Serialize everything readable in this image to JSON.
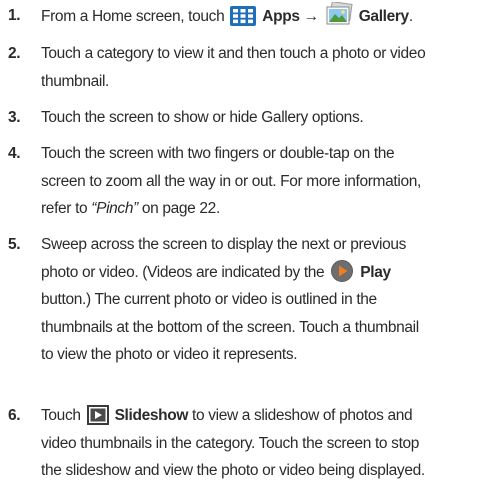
{
  "steps": [
    {
      "num": "1.",
      "parts": {
        "a": "From a Home screen, touch",
        "apps": "Apps",
        "arrow": "→",
        "gallery": "Gallery",
        "end": "."
      }
    },
    {
      "num": "2.",
      "lines": [
        "Touch a category to view it and then touch a photo or video",
        "thumbnail."
      ]
    },
    {
      "num": "3.",
      "lines": [
        "Touch the screen to show or hide Gallery options."
      ]
    },
    {
      "num": "4.",
      "lines": [
        "Touch the screen with two fingers or double-tap on the",
        "screen to zoom all the way in or out. For more information,"
      ],
      "line3": {
        "a": "refer to ",
        "ref": "“Pinch”",
        "b": " on page 22."
      }
    },
    {
      "num": "5.",
      "line1": "Sweep across the screen to display the next or previous",
      "line2": {
        "a": "photo or video. (Videos are indicated by the",
        "play": "Play"
      },
      "lines": [
        "button.) The current photo or video is outlined in the",
        "thumbnails at the bottom of the screen. Touch a thumbnail",
        "to view the photo or video it represents."
      ]
    },
    {
      "num": "6.",
      "line1": {
        "a": "Touch",
        "slideshow": "Slideshow",
        "b": "to view a slideshow of photos and"
      },
      "lines": [
        "video thumbnails in the category. Touch the screen to stop",
        "the slideshow and view the photo or video being displayed."
      ]
    }
  ],
  "icons": {
    "apps": "apps-grid-icon",
    "gallery": "gallery-photo-icon",
    "play": "play-icon",
    "slideshow": "slideshow-icon"
  },
  "colors": {
    "text": "#2b2b2b",
    "apps_blue": "#1f6fb8",
    "play_gray": "#6e6e6e",
    "play_orange": "#f07d1e"
  }
}
